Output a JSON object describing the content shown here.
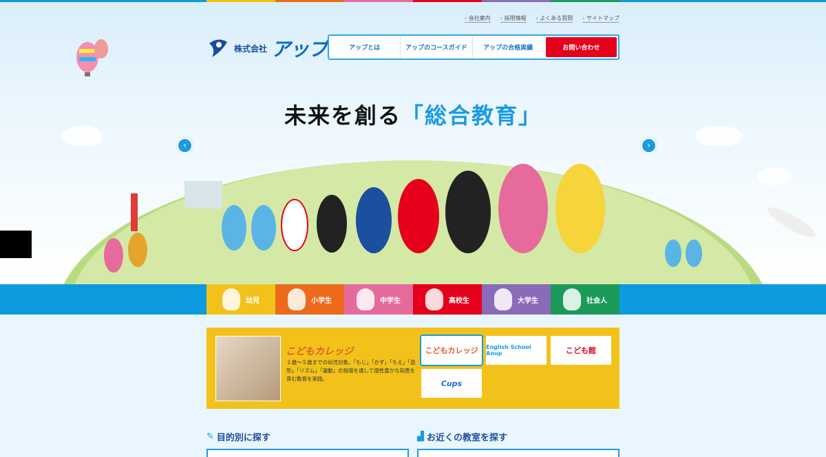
{
  "top_stripe_colors": [
    "#0d9be0",
    "#0d9be0",
    "#0d9be0",
    "#f0c400",
    "#ec6a1a",
    "#e66a9c",
    "#e5001c",
    "#8a6bb8",
    "#1b9a5a",
    "#0d9be0",
    "#0d9be0",
    "#0d9be0"
  ],
  "utility_links": [
    "会社案内",
    "採用情報",
    "よくある質問",
    "サイトマップ"
  ],
  "logo": {
    "company": "株式会社",
    "name": "アップ"
  },
  "nav": [
    "アップとは",
    "アップのコースガイド",
    "アップの合格実績",
    "お問い合わせ"
  ],
  "hero": {
    "headline_pre": "未来を創る",
    "headline_hl": "「総合教育」",
    "prev_icon": "chevron-left-icon",
    "next_icon": "chevron-right-icon"
  },
  "tabs": [
    {
      "label": "幼児",
      "color": "#f2c21b"
    },
    {
      "label": "小学生",
      "color": "#ec6a1a"
    },
    {
      "label": "中学生",
      "color": "#e66a9c"
    },
    {
      "label": "高校生",
      "color": "#e5001c"
    },
    {
      "label": "大学生",
      "color": "#8a6bb8"
    },
    {
      "label": "社会人",
      "color": "#1b9a5a"
    }
  ],
  "panel": {
    "title": "こどもカレッジ",
    "desc": "２歳～５歳までの幼児対象。「もじ」「かず」「ちえ」「造形」「リズム」「運動」の指導を通して個性豊かな知恵を育む教育を実践。",
    "logos": [
      {
        "label": "こどもカレッジ",
        "color": "#e55a2b"
      },
      {
        "label": "English School Anup",
        "color": "#1a9be0"
      },
      {
        "label": "こども館",
        "color": "#e5001c"
      },
      {
        "label": "Cups",
        "color": "#1a6ed0"
      }
    ]
  },
  "sections": {
    "purpose": "目的別に探す",
    "nearby": "お近くの教室を探す"
  }
}
